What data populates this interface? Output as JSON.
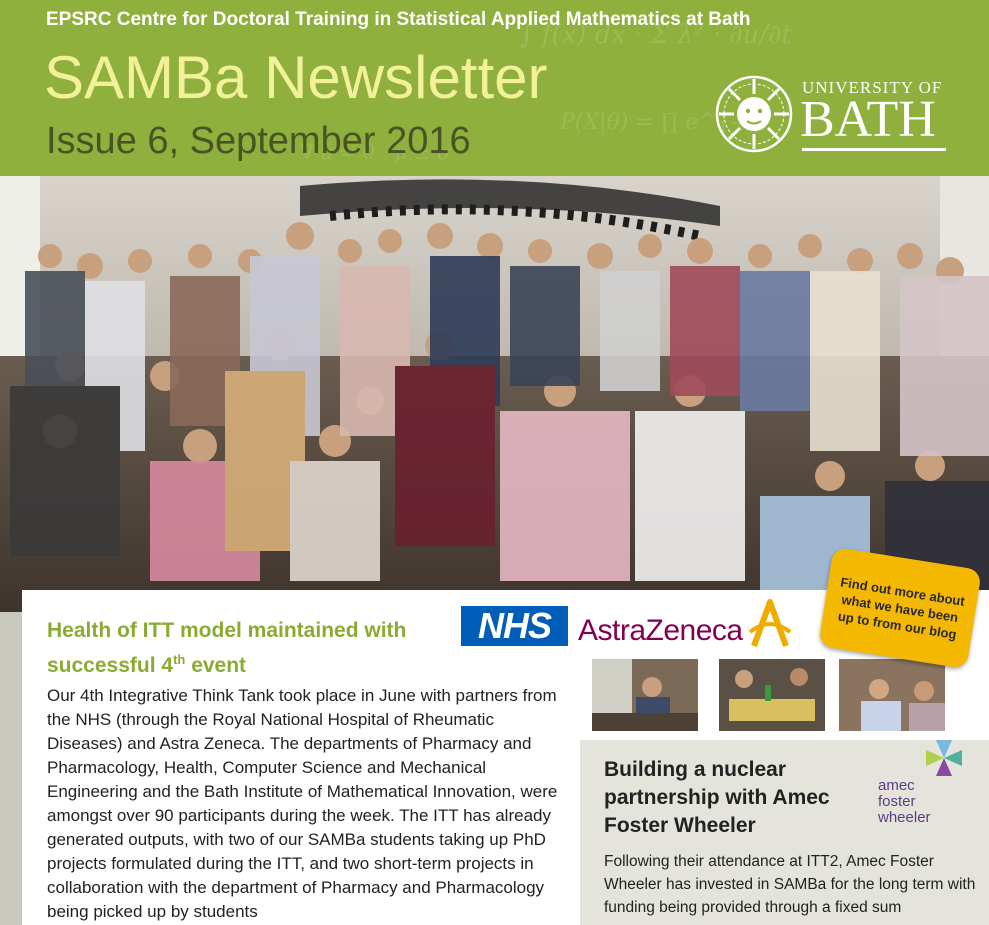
{
  "header": {
    "kicker": "EPSRC Centre for Doctoral Training in Statistical Applied Mathematics at Bath",
    "title": "SAMBa Newsletter",
    "issue": "Issue 6, September 2016",
    "background_color": "#8fb03c",
    "title_color": "#f3f09a"
  },
  "logo": {
    "univ": "UNIVERSITY OF",
    "name": "BATH",
    "icon": "bath-sun-seal-icon"
  },
  "photo": {
    "icon": "group-photo"
  },
  "article": {
    "title_part1": "Health of ITT model maintained with successful 4",
    "title_sup": "th",
    "title_part2": " event",
    "body": "Our 4th Integrative Think Tank took place in June with partners from the NHS (through the Royal National Hospital of Rheumatic Diseases) and Astra Zeneca. The departments of Pharmacy and Pharmacology, Health, Computer Science and Mechanical Engineering and the Bath Institute of Mathematical Innovation, were amongst over 90 participants during the week. The ITT has already generated outputs, with two of our SAMBa students taking up PhD projects formulated during the ITT, and two short-term projects in collaboration with the department of Pharmacy and Pharmacology being picked up by students",
    "title_color": "#8aab32"
  },
  "partners": {
    "nhs": "NHS",
    "astrazeneca": "AstraZeneca",
    "nhs_color": "#005eb8",
    "az_color": "#830051"
  },
  "callout": {
    "text": "Find out more about what we have been up to from our blog",
    "color": "#f5b800"
  },
  "sidebar": {
    "title": "Building a nuclear partnership with Amec Foster Wheeler",
    "logo_text_1": "amec",
    "logo_text_2": "foster",
    "logo_text_3": "wheeler",
    "body": "Following their attendance at ITT2, Amec Foster Wheeler has invested in SAMBa for the long term with funding being provided through a fixed sum"
  }
}
